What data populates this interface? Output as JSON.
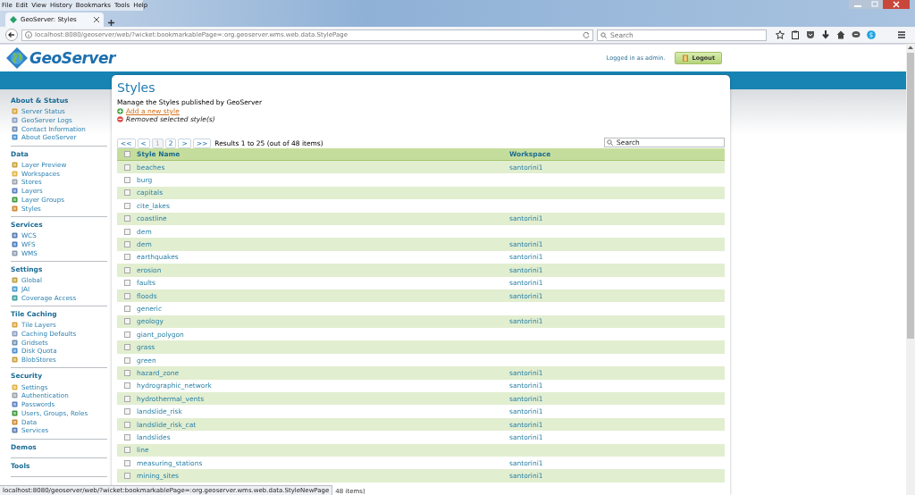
{
  "browser": {
    "menu": [
      "File",
      "Edit",
      "View",
      "History",
      "Bookmarks",
      "Tools",
      "Help"
    ],
    "tabs": [
      {
        "title": "GeoServer: Styles",
        "selected": true
      }
    ],
    "url": "localhost:8080/geoserver/web/?wicket:bookmarkablePage=:org.geoserver.wms.web.data.StylePage",
    "search": {
      "placeholder": "Search"
    }
  },
  "header": {
    "logo": "GeoServer",
    "login_text": "Logged in as admin.",
    "logout": "Logout"
  },
  "sidebar": {
    "sections": [
      {
        "title": "About & Status",
        "items": [
          "Server Status",
          "GeoServer Logs",
          "Contact Information",
          "About GeoServer"
        ]
      },
      {
        "title": "Data",
        "items": [
          "Layer Preview",
          "Workspaces",
          "Stores",
          "Layers",
          "Layer Groups",
          "Styles"
        ]
      },
      {
        "title": "Services",
        "items": [
          "WCS",
          "WFS",
          "WMS"
        ]
      },
      {
        "title": "Settings",
        "items": [
          "Global",
          "JAI",
          "Coverage Access"
        ]
      },
      {
        "title": "Tile Caching",
        "items": [
          "Tile Layers",
          "Caching Defaults",
          "Gridsets",
          "Disk Quota",
          "BlobStores"
        ]
      },
      {
        "title": "Security",
        "items": [
          "Settings",
          "Authentication",
          "Passwords",
          "Users, Groups, Roles",
          "Data",
          "Services"
        ]
      },
      {
        "title": "Demos"
      },
      {
        "title": "Tools"
      }
    ]
  },
  "page": {
    "title": "Styles",
    "description": "Manage the Styles published by GeoServer",
    "actions": [
      {
        "kind": "link",
        "label": "Add a new style"
      },
      {
        "kind": "message",
        "label": "Removed selected style(s)"
      }
    ],
    "pager": {
      "buttons": [
        {
          "label": "<<",
          "selected": false
        },
        {
          "label": "<",
          "selected": false
        },
        {
          "label": "1",
          "selected": true
        },
        {
          "label": "2",
          "selected": false
        },
        {
          "label": ">",
          "selected": false
        },
        {
          "label": ">>",
          "selected": false
        }
      ],
      "summary": "Results 1 to 25 (out of 48 items)"
    },
    "search": {
      "placeholder": "Search"
    },
    "table": {
      "columns": [
        "Style Name",
        "Workspace"
      ],
      "select_all_checked": false,
      "rows": [
        {
          "name": "beaches",
          "workspace": "santorini1",
          "checked": false
        },
        {
          "name": "burg",
          "checked": false
        },
        {
          "name": "capitals",
          "checked": false
        },
        {
          "name": "cite_lakes",
          "checked": false
        },
        {
          "name": "coastline",
          "workspace": "santorini1",
          "checked": false
        },
        {
          "name": "dem",
          "checked": false
        },
        {
          "name": "dem",
          "workspace": "santorini1",
          "checked": false
        },
        {
          "name": "earthquakes",
          "workspace": "santorini1",
          "checked": false
        },
        {
          "name": "erosion",
          "workspace": "santorini1",
          "checked": false
        },
        {
          "name": "faults",
          "workspace": "santorini1",
          "checked": false
        },
        {
          "name": "floods",
          "workspace": "santorini1",
          "checked": false
        },
        {
          "name": "generic",
          "checked": false
        },
        {
          "name": "geology",
          "workspace": "santorini1",
          "checked": false
        },
        {
          "name": "giant_polygon",
          "checked": false
        },
        {
          "name": "grass",
          "checked": false
        },
        {
          "name": "green",
          "checked": false
        },
        {
          "name": "hazard_zone",
          "workspace": "santorini1",
          "checked": false
        },
        {
          "name": "hydrographic_network",
          "workspace": "santorini1",
          "checked": false
        },
        {
          "name": "hydrothermal_vents",
          "workspace": "santorini1",
          "checked": false
        },
        {
          "name": "landslide_risk",
          "workspace": "santorini1",
          "checked": false
        },
        {
          "name": "landslide_risk_cat",
          "workspace": "santorini1",
          "checked": false
        },
        {
          "name": "landslides",
          "workspace": "santorini1",
          "checked": false
        },
        {
          "name": "line",
          "checked": false
        },
        {
          "name": "measuring_stations",
          "workspace": "santorini1",
          "checked": false
        },
        {
          "name": "mining_sites",
          "workspace": "santorini1",
          "checked": false
        }
      ]
    },
    "bottom_pager_fragment": "48 items)"
  },
  "status_bar": "localhost:8080/geoserver/web/?wicket:bookmarkablePage=:org.geoserver.wms.web.data.StyleNewPage"
}
